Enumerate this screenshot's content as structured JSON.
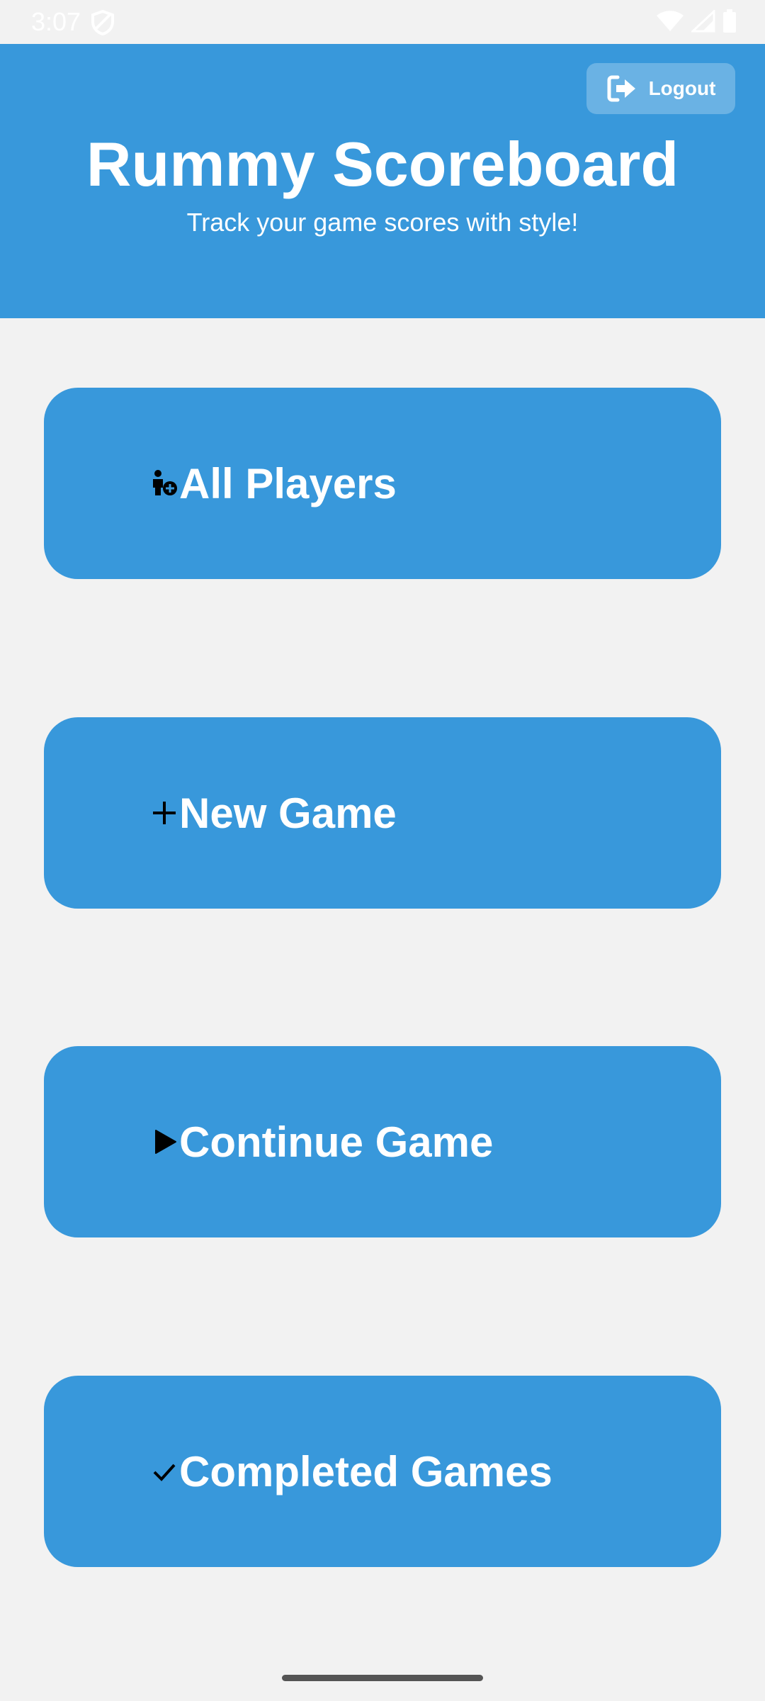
{
  "status_bar": {
    "time": "3:07"
  },
  "header": {
    "title": "Rummy Scoreboard",
    "subtitle": "Track your game scores with style!",
    "logout_label": "Logout"
  },
  "menu": [
    {
      "label": "All Players",
      "icon": "person-add-icon"
    },
    {
      "label": "New Game",
      "icon": "plus-icon"
    },
    {
      "label": "Continue Game",
      "icon": "play-icon"
    },
    {
      "label": "Completed Games",
      "icon": "checkmark-icon"
    }
  ],
  "colors": {
    "primary": "#3898db",
    "background": "#f2f2f2",
    "text_on_primary": "#ffffff"
  }
}
